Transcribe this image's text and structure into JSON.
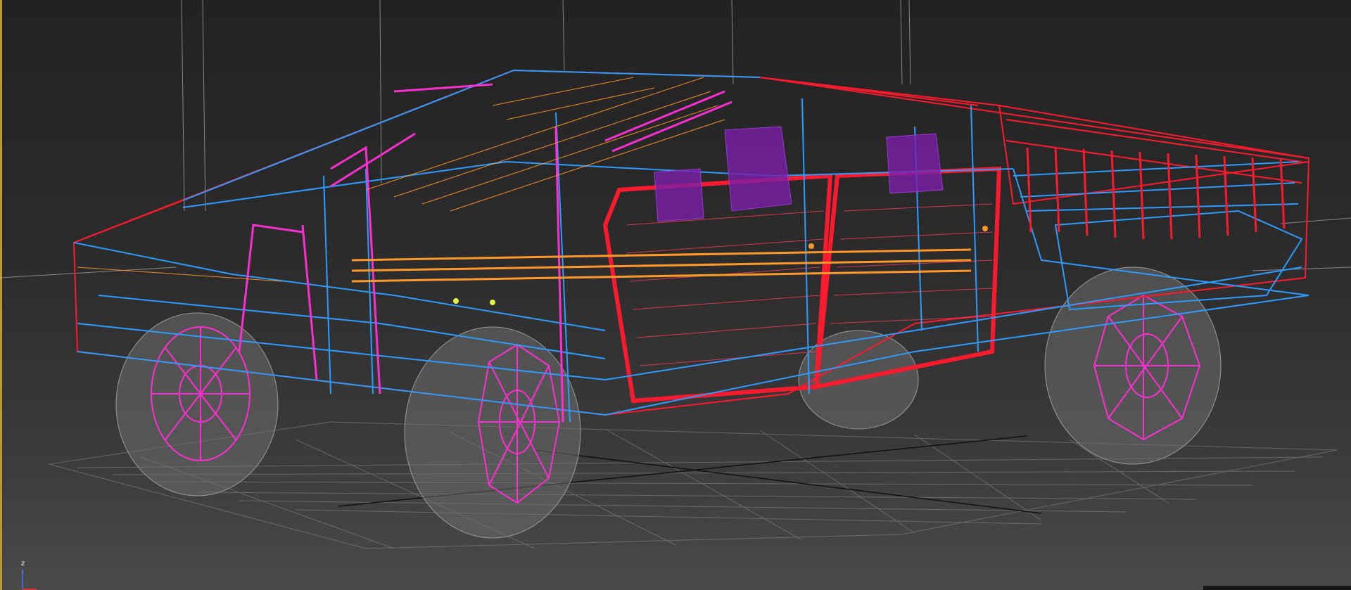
{
  "viewport": {
    "mode": "wireframe",
    "object": "pickup-truck-wireframe",
    "background": "#2a2a2a",
    "accent_border": "#b79a3a"
  },
  "colors": {
    "body_red": "#ff1a2e",
    "frame_blue": "#2f9bff",
    "trim_magenta": "#ff2fd0",
    "seat_purple": "#7a1ea8",
    "glass_orange": "#ff9a2a",
    "tire_grey": "#6e6e6e",
    "grid": "#8a8a8a"
  },
  "gizmo": {
    "z_label": "z"
  }
}
